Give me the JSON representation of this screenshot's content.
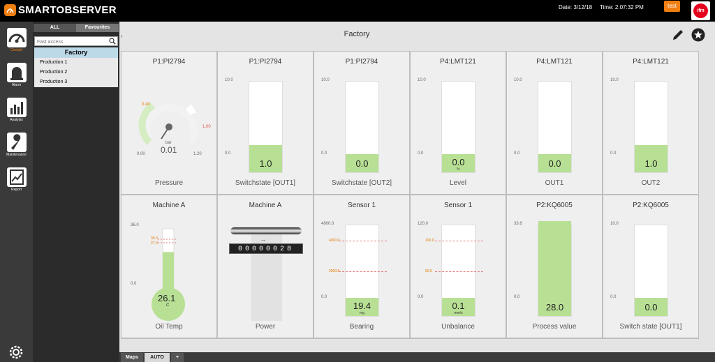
{
  "app": {
    "name": "SMARTOBSERVER",
    "date_label": "Date: 3/12/18",
    "time_label": "Time: 2:07:32 PM",
    "user": "test"
  },
  "sidebar": {
    "items": [
      {
        "label": "Cockpit",
        "icon": "gauge-icon"
      },
      {
        "label": "Alarm",
        "icon": "alarm-icon"
      },
      {
        "label": "Analysis",
        "icon": "chart-icon"
      },
      {
        "label": "Maintenance",
        "icon": "wrench-icon"
      },
      {
        "label": "Report",
        "icon": "report-icon"
      }
    ]
  },
  "panel": {
    "tab_all": "ALL",
    "tab_fav": "Favourites",
    "search_placeholder": "Fast access",
    "tree_title": "Factory",
    "tree_items": [
      "Production 1",
      "Production 2",
      "Production 3"
    ]
  },
  "main": {
    "title": "Factory",
    "collapse": "‹"
  },
  "tiles": [
    {
      "title": "P1:PI2794",
      "label": "Pressure",
      "type": "gauge",
      "value": "0.01",
      "unit": "bar",
      "min": "0.00",
      "max": "1.20",
      "warn": "0.40",
      "alarm": "1.00"
    },
    {
      "title": "P1:PI2794",
      "label": "Switchstate [OUT1]",
      "type": "bar",
      "value": "1.0",
      "unit": "",
      "top": "10.0",
      "bottom": "0.0",
      "fill": 0.1
    },
    {
      "title": "P1:PI2794",
      "label": "Switchstate [OUT2]",
      "type": "bar",
      "value": "0.0",
      "unit": "",
      "top": "10.0",
      "bottom": "0.0",
      "fill": 0.0
    },
    {
      "title": "P4:LMT121",
      "label": "Level",
      "type": "bar",
      "value": "0.0",
      "unit": "%",
      "top": "10.0",
      "bottom": "0.0",
      "fill": 0.0
    },
    {
      "title": "P4:LMT121",
      "label": "OUT1",
      "type": "bar",
      "value": "0.0",
      "unit": "",
      "top": "10.0",
      "bottom": "0.0",
      "fill": 0.0
    },
    {
      "title": "P4:LMT121",
      "label": "OUT2",
      "type": "bar",
      "value": "1.0",
      "unit": "",
      "top": "10.0",
      "bottom": "0.0",
      "fill": 0.1
    },
    {
      "title": "Machine A",
      "label": "Oil Temp",
      "type": "thermo",
      "value": "26.1",
      "unit": "C",
      "top": "36.0",
      "bottom": "0.0",
      "t1": "30.0",
      "t2": "27.0",
      "fill": 0.725
    },
    {
      "title": "Machine A",
      "label": "Power",
      "type": "counter",
      "digits": "00000028"
    },
    {
      "title": "Sensor 1",
      "label": "Bearing",
      "type": "bar",
      "value": "19.4",
      "unit": "mg",
      "top": "4800.0",
      "bottom": "0.0",
      "fill": 0.0,
      "thresholds": [
        "4000.0",
        "2000.0"
      ]
    },
    {
      "title": "Sensor 1",
      "label": "Unbalance",
      "type": "bar",
      "value": "0.1",
      "unit": "mm/s",
      "top": "120.0",
      "bottom": "0.0",
      "fill": 0.0,
      "thresholds": [
        "100.0",
        "50.0"
      ]
    },
    {
      "title": "P2:KQ6005",
      "label": "Process value",
      "type": "bar",
      "value": "28.0",
      "unit": "",
      "top": "33.6",
      "bottom": "0.0",
      "fill": 0.83
    },
    {
      "title": "P2:KQ6005",
      "label": "Switch state [OUT1]",
      "type": "bar",
      "value": "0.0",
      "unit": "",
      "top": "10.0",
      "bottom": "0.0",
      "fill": 0.0
    }
  ],
  "bottom_tabs": [
    "Maps",
    "AUTO",
    "+"
  ],
  "colors": {
    "accent": "#f07e11",
    "fill": "#b8e094",
    "alarm": "#e87a7a"
  }
}
